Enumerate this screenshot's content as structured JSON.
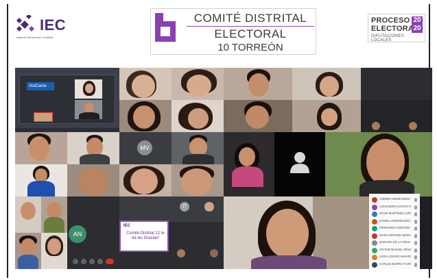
{
  "header": {
    "iec_logo_text": "IEC",
    "iec_subtitle": "Instituto Electoral de Coahuila",
    "comite_line1": "COMITÉ DISTRITAL",
    "comite_line2": "ELECTORAL",
    "comite_line3": "10 TORREÓN",
    "proceso_line1": "PROCESO",
    "proceso_line2": "ELECTORAL",
    "proceso_year_a": "20",
    "proceso_year_b": "20",
    "proceso_line3": "DIPUTACIONES LOCALES"
  },
  "colors": {
    "brand_purple": "#4b2a7b",
    "accent_purple": "#8a3fb3",
    "meeting_bg": "#1e1f22"
  },
  "tiles": {
    "avatar_mv": "MV",
    "avatar_an": "AN",
    "avatar_jt": "JT",
    "visita_label": "VisiCame"
  },
  "slide": {
    "logo": "IEC",
    "text": "Comité Distrital 12 te da las Gracias!"
  },
  "participants": [
    {
      "name": "ANDREA HERNÁNDEZ VIVALDO",
      "color": "#c0392b"
    },
    {
      "name": "ALEJANDRO GARCÍA RUIZ",
      "color": "#8e44ad"
    },
    {
      "name": "KEVIN MARTÍNEZ LÓPEZ",
      "color": "#2980b9"
    },
    {
      "name": "DANIELA RODRÍGUEZ SOTO",
      "color": "#d35400"
    },
    {
      "name": "FERNANDO SÁNCHEZ GIL",
      "color": "#16a085"
    },
    {
      "name": "DIANA ESPARZA MORALES",
      "color": "#c0392b"
    },
    {
      "name": "MARIANA DE LA CRUZ",
      "color": "#7f8c8d"
    },
    {
      "name": "VICTOR MANUEL REYES",
      "color": "#27ae60"
    },
    {
      "name": "SARA LOZANO NAVARRO",
      "color": "#e67e22"
    },
    {
      "name": "CARLOS IBARRA FLORES",
      "color": "#34495e"
    }
  ],
  "icons": {
    "user_placeholder": "user-silhouette-icon",
    "mic": "mic-icon",
    "camera": "camera-icon"
  }
}
